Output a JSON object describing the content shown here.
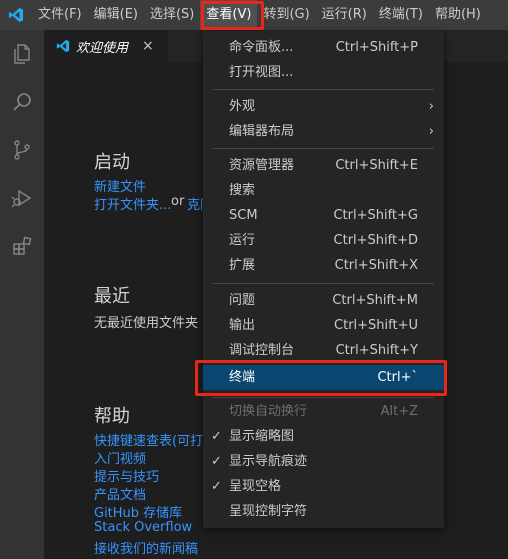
{
  "menubar": {
    "items": [
      "文件(F)",
      "编辑(E)",
      "选择(S)",
      "查看(V)",
      "转到(G)",
      "运行(R)",
      "终端(T)",
      "帮助(H)"
    ],
    "active_index": 3
  },
  "tab": {
    "title": "欢迎使用",
    "close": "×"
  },
  "welcome": {
    "start": {
      "heading": "启动",
      "new_file": "新建文件",
      "open_folder": "打开文件夹...",
      "or": " or ",
      "clone": "克隆"
    },
    "recent": {
      "heading": "最近",
      "empty": "无最近使用文件夹"
    },
    "help": {
      "heading": "帮助",
      "links": [
        "快捷键速查表(可打",
        "入门视频",
        "提示与技巧",
        "产品文档",
        "GitHub 存储库",
        "Stack Overflow",
        "接收我们的新闻稿"
      ]
    }
  },
  "view_menu": {
    "items": [
      {
        "label": "命令面板...",
        "shortcut": "Ctrl+Shift+P"
      },
      {
        "label": "打开视图...",
        "shortcut": ""
      },
      {
        "label": "外观",
        "shortcut": "",
        "submenu": true
      },
      {
        "label": "编辑器布局",
        "shortcut": "",
        "submenu": true
      },
      {
        "label": "资源管理器",
        "shortcut": "Ctrl+Shift+E"
      },
      {
        "label": "搜索",
        "shortcut": ""
      },
      {
        "label": "SCM",
        "shortcut": "Ctrl+Shift+G"
      },
      {
        "label": "运行",
        "shortcut": "Ctrl+Shift+D"
      },
      {
        "label": "扩展",
        "shortcut": "Ctrl+Shift+X"
      },
      {
        "label": "问题",
        "shortcut": "Ctrl+Shift+M"
      },
      {
        "label": "输出",
        "shortcut": "Ctrl+Shift+U"
      },
      {
        "label": "调试控制台",
        "shortcut": "Ctrl+Shift+Y"
      },
      {
        "label": "终端",
        "shortcut": "Ctrl+`",
        "selected": true
      },
      {
        "label": "切换自动换行",
        "shortcut": "Alt+Z",
        "disabled": true
      },
      {
        "label": "显示缩略图",
        "shortcut": "",
        "checked": true
      },
      {
        "label": "显示导航痕迹",
        "shortcut": "",
        "checked": true
      },
      {
        "label": "呈现空格",
        "shortcut": "",
        "checked": true
      },
      {
        "label": "呈现控制字符",
        "shortcut": ""
      }
    ],
    "submenu_arrow": "›",
    "check_mark": "✓"
  },
  "colors": {
    "accent": "#007acc",
    "highlight": "#e8261a",
    "selection": "#094771",
    "link": "#3794ff"
  },
  "icons": [
    "vscode-logo-icon",
    "explorer-icon",
    "search-icon",
    "source-control-icon",
    "run-debug-icon",
    "extensions-icon"
  ]
}
